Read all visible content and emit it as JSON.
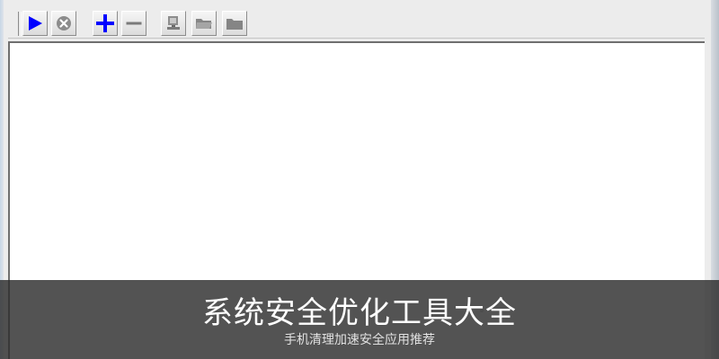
{
  "toolbar": {
    "buttons": [
      {
        "name": "play",
        "icon": "play-icon",
        "color": "#0000ff"
      },
      {
        "name": "stop",
        "icon": "stop-circle-icon",
        "color": "#8c8c8c"
      },
      {
        "name": "add",
        "icon": "plus-icon",
        "color": "#0000ff"
      },
      {
        "name": "remove",
        "icon": "minus-icon",
        "color": "#7b7b7b"
      },
      {
        "name": "computer",
        "icon": "computer-icon",
        "color": "#7b7b7b"
      },
      {
        "name": "open-folder",
        "icon": "folder-open-icon",
        "color": "#7b7b7b"
      },
      {
        "name": "folder",
        "icon": "folder-icon",
        "color": "#7b7b7b"
      }
    ]
  },
  "caption": {
    "title": "系统安全优化工具大全",
    "subtitle": "手机清理加速安全应用推荐"
  }
}
